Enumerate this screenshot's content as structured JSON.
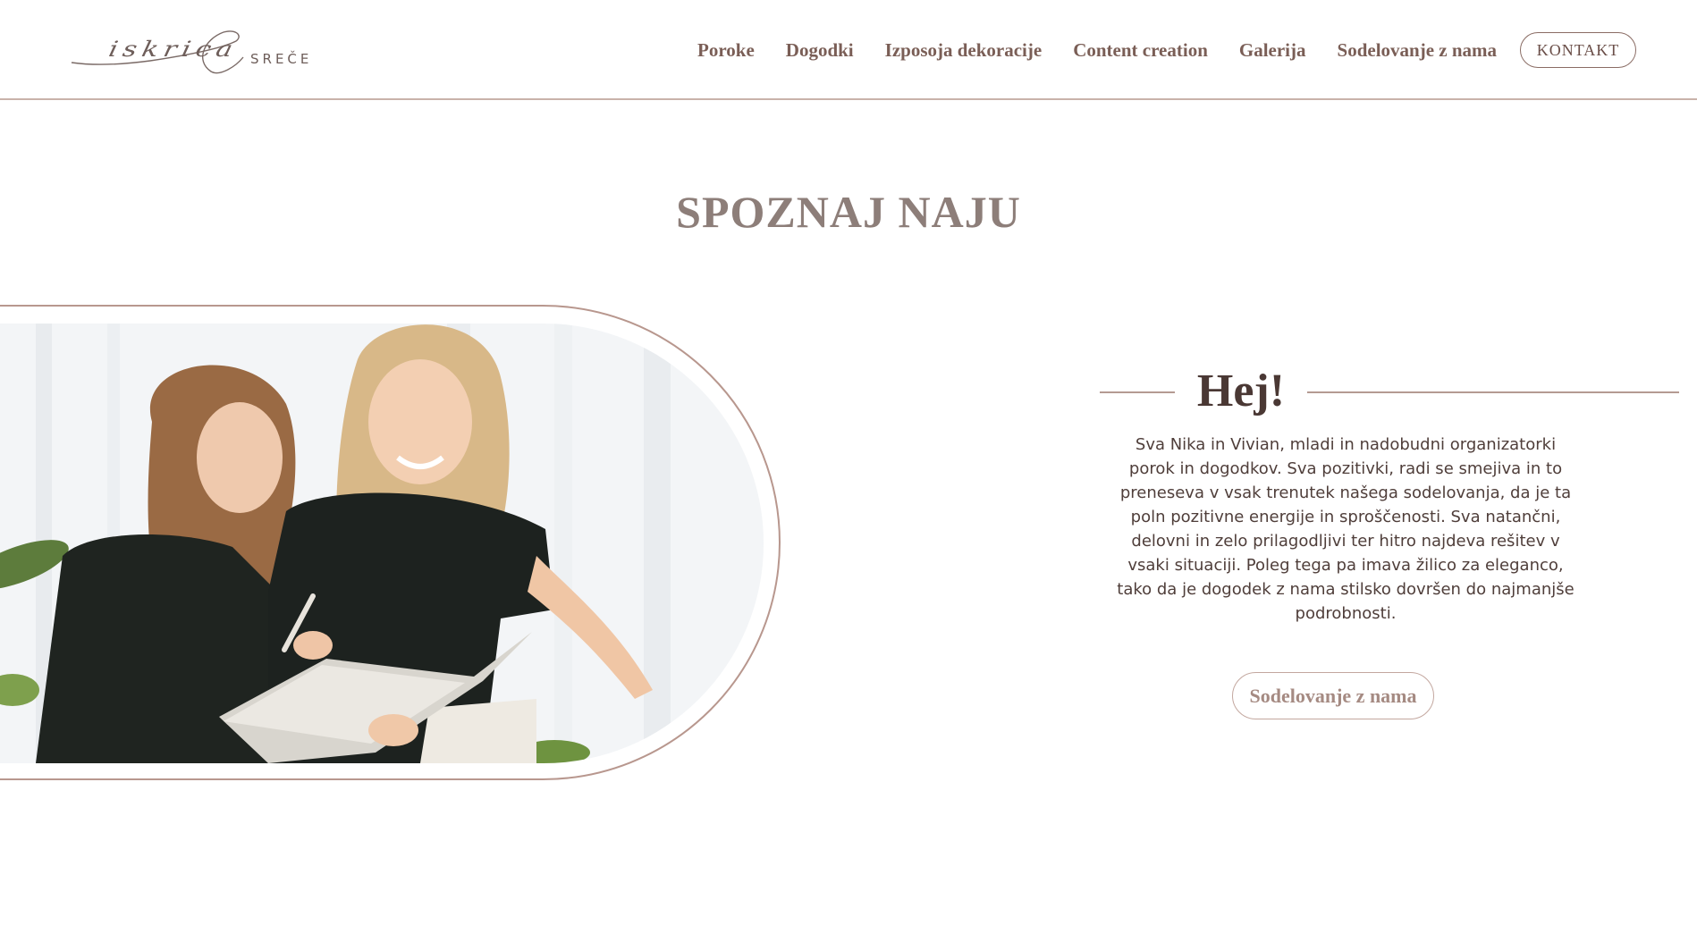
{
  "header": {
    "logo": {
      "script": "iskrica",
      "word": "SREČE"
    },
    "nav": [
      {
        "label": "Poroke"
      },
      {
        "label": "Dogodki"
      },
      {
        "label": "Izposoja dekoracije"
      },
      {
        "label": "Content creation"
      },
      {
        "label": "Galerija"
      },
      {
        "label": "Sodelovanje z nama"
      }
    ],
    "contact_label": "KONTAKT"
  },
  "main": {
    "title": "SPOZNAJ NAJU",
    "greeting": "Hej!",
    "intro": "Sva Nika in Vivian, mladi in nadobudni organizatorki porok in dogodkov. Sva pozitivki, radi se smejiva in to preneseva v vsak trenutek našega sodelovanja, da je ta poln pozitivne energije in sproščenosti. Sva natančni, delovni in zelo prilagodljivi ter hitro najdeva rešitev v vsaki situaciji. Poleg tega pa imava žilico za eleganco, tako da je  dogodek z nama stilsko dovršen do najmanjše podrobnosti.",
    "cta_label": "Sodelovanje z nama"
  },
  "colors": {
    "accent": "#b49a92",
    "nav_text": "#7a5e56",
    "title": "#8d7e79",
    "body_text": "#4f3e3a"
  }
}
